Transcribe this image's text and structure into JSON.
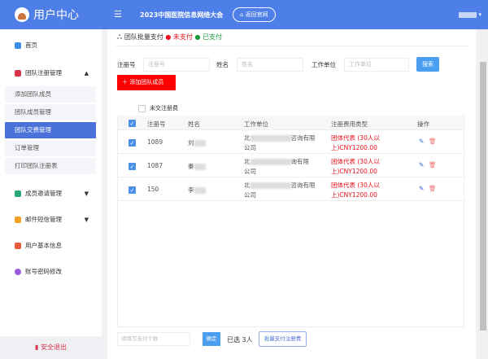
{
  "header": {
    "logo": "用户中心",
    "conference": "2023中国医院信息网络大会",
    "home_button": "返回官网"
  },
  "sidebar": {
    "items": [
      {
        "label": "首页"
      },
      {
        "label": "团队注册管理",
        "subitems": [
          "添加团队成员",
          "团队成员管理",
          "团队交费管理",
          "订单管理",
          "打印团队注册表"
        ]
      },
      {
        "label": "成员邀请管理"
      },
      {
        "label": "邮件短信管理"
      },
      {
        "label": "用户基本信息"
      },
      {
        "label": "账号密码修改"
      }
    ],
    "logout": "安全退出"
  },
  "main": {
    "title": "团队批量支付",
    "legend_unpaid": "未支付",
    "legend_paid": "已支付",
    "filters": {
      "reg_label": "注册号",
      "reg_placeholder": "注册号",
      "name_label": "姓名",
      "name_placeholder": "姓名",
      "unit_label": "工作单位",
      "unit_placeholder": "工作单位",
      "search": "搜索"
    },
    "add_button": "添加团队成员",
    "unpaid_filter": "未交注册费",
    "columns": [
      "注册号",
      "姓名",
      "工作单位",
      "注册费用类型",
      "操作"
    ],
    "rows": [
      {
        "id": "1089",
        "name": "刘",
        "unit_start": "北",
        "unit_end": "咨询有限",
        "unit_line2": "公司",
        "fee": "团体代表 (30人以上)CNY1200.00"
      },
      {
        "id": "1087",
        "name": "秦",
        "unit_start": "北",
        "unit_end": "询有限",
        "unit_line2": "公司",
        "fee": "团体代表 (30人以上)CNY1200.00"
      },
      {
        "id": "150",
        "name": "李",
        "unit_start": "北",
        "unit_end": "咨询有限",
        "unit_line2": "公司",
        "fee": "团体代表 (30人以上)CNY1200.00"
      }
    ],
    "footer": {
      "pay_placeholder": "请填写支付个数",
      "confirm": "确定",
      "selected": "已选 3人",
      "batch_pay": "批量支付注册费"
    }
  }
}
